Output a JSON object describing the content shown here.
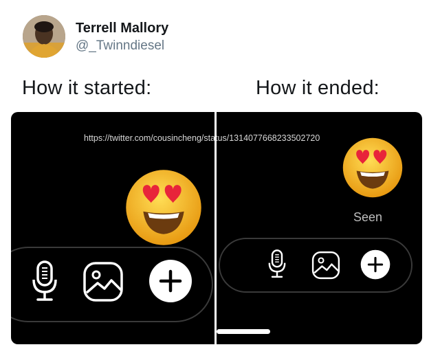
{
  "tweet": {
    "author_name": "Terrell Mallory",
    "author_handle": "@_Twinndiesel",
    "caption_left": "How it started:",
    "caption_right": "How it ended:"
  },
  "image": {
    "watermark": "https://twitter.com/cousincheng/status/1314077668233502720",
    "left_panel": {
      "emoji": "heart-eyes-emoji",
      "toolbar": [
        "microphone-icon",
        "image-icon",
        "plus-icon"
      ]
    },
    "right_panel": {
      "emoji": "heart-eyes-emoji",
      "status_text": "Seen",
      "toolbar": [
        "microphone-icon",
        "image-icon",
        "plus-icon"
      ]
    }
  },
  "colors": {
    "name": "#14171a",
    "handle": "#657786",
    "panel_bg": "#000000",
    "seen": "#bdbdbd",
    "emoji_face": "#f4b31f",
    "heart": "#e8243a"
  }
}
